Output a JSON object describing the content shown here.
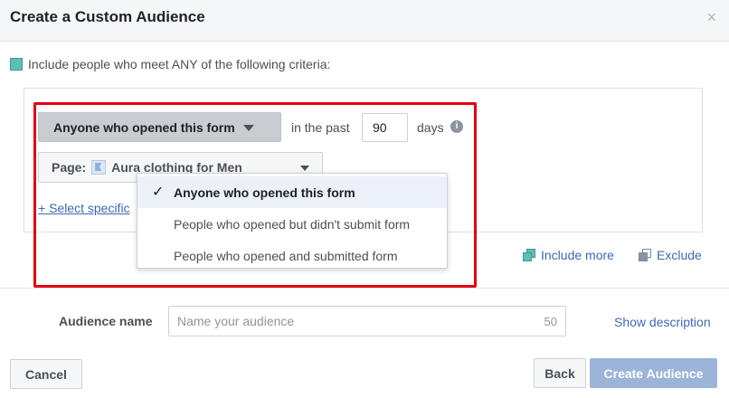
{
  "dialog": {
    "title": "Create a Custom Audience",
    "close_glyph": "×"
  },
  "criteria": {
    "text": "Include people who meet ANY of the following criteria:",
    "icon": "teal-square-icon",
    "accent_color": "#5fbfb2"
  },
  "rule": {
    "event_label": "Anyone who opened this form",
    "past_label": "in the past",
    "days_value": "90",
    "days_label": "days",
    "info_glyph": "i",
    "page_prefix": "Page:",
    "page_name": "Aura clothing for Men",
    "select_specific_link": "+ Select specific"
  },
  "dropdown": {
    "items": [
      {
        "label": "Anyone who opened this form",
        "selected": true
      },
      {
        "label": "People who opened but didn't submit form",
        "selected": false
      },
      {
        "label": "People who opened and submitted form",
        "selected": false
      }
    ],
    "check_glyph": "✓"
  },
  "actions": {
    "include_more": "Include more",
    "exclude": "Exclude"
  },
  "audience": {
    "label": "Audience name",
    "placeholder": "Name your audience",
    "char_limit": "50",
    "show_description": "Show description"
  },
  "footer": {
    "cancel": "Cancel",
    "back": "Back",
    "create": "Create Audience"
  },
  "colors": {
    "link": "#4267b2",
    "highlight_outline": "#e3000f",
    "primary_disabled": "#9cb4d8"
  }
}
